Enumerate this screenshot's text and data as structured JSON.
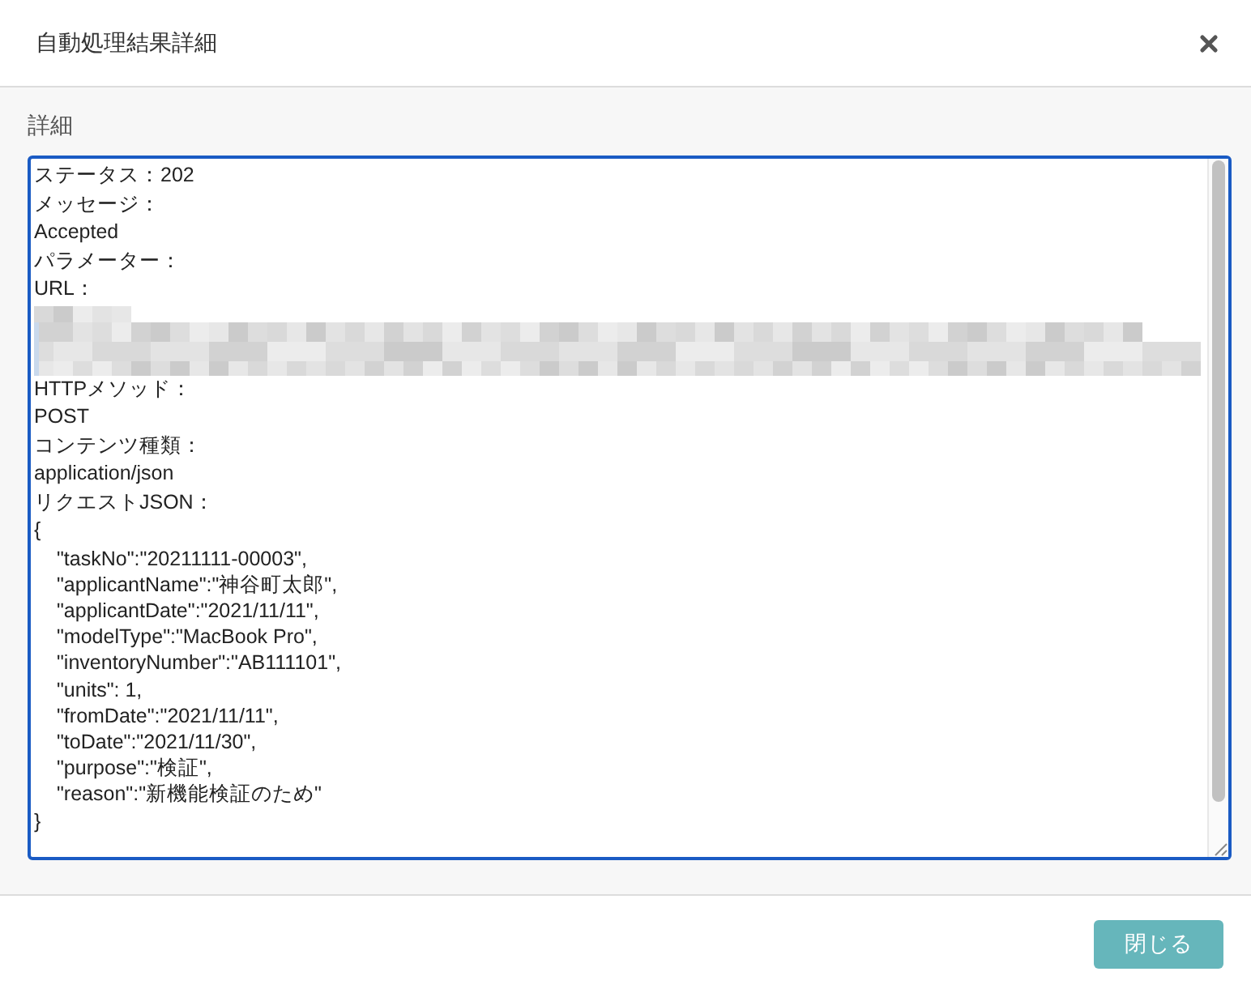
{
  "dialog": {
    "title": "自動処理結果詳細"
  },
  "details": {
    "label": "詳細",
    "lines": [
      {
        "kind": "text",
        "text": "ステータス：202"
      },
      {
        "kind": "text",
        "text": "メッセージ："
      },
      {
        "kind": "text",
        "text": "Accepted"
      },
      {
        "kind": "text",
        "text": "パラメーター："
      },
      {
        "kind": "text",
        "text": "URL："
      },
      {
        "kind": "redacted"
      },
      {
        "kind": "text",
        "text": "HTTPメソッド："
      },
      {
        "kind": "text",
        "text": "POST"
      },
      {
        "kind": "text",
        "text": "コンテンツ種類："
      },
      {
        "kind": "text",
        "text": "application/json"
      },
      {
        "kind": "text",
        "text": "リクエストJSON："
      },
      {
        "kind": "text",
        "text": "{",
        "children": [
          {
            "text": "\"taskNo\":\"20211111-00003\","
          },
          {
            "text": "\"applicantName\":\"神谷町太郎\","
          },
          {
            "text": "\"applicantDate\":\"2021/11/11\","
          },
          {
            "text": "\"modelType\":\"MacBook Pro\","
          },
          {
            "text": "\"inventoryNumber\":\"AB111101\","
          },
          {
            "text": "\"units\": 1,"
          },
          {
            "text": "\"fromDate\":\"2021/11/11\","
          },
          {
            "text": "\"toDate\":\"2021/11/30\","
          },
          {
            "text": "\"purpose\":\"検証\","
          },
          {
            "text": "\"reason\":\"新機能検証のため\""
          }
        ]
      },
      {
        "kind": "text",
        "text": "}"
      }
    ]
  },
  "footer": {
    "buttons": [
      {
        "label": "閉じる"
      }
    ]
  }
}
